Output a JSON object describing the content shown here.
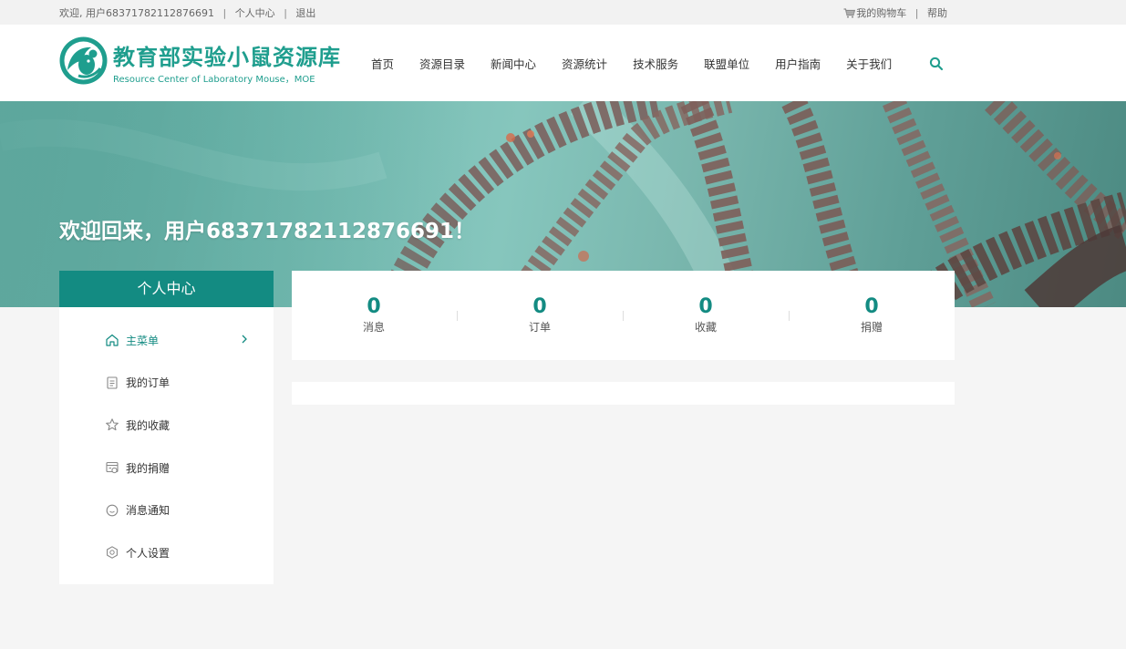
{
  "topbar": {
    "welcome": "欢迎, 用户68371782112876691",
    "sep1": "|",
    "personal_center": "个人中心",
    "sep2": "|",
    "logout": "退出",
    "cart": "我的购物车",
    "sep3": "|",
    "help": "帮助"
  },
  "logo": {
    "cn": "教育部实验小鼠资源库",
    "en": "Resource Center of Laboratory Mouse，MOE"
  },
  "nav": {
    "items": [
      "首页",
      "资源目录",
      "新闻中心",
      "资源统计",
      "技术服务",
      "联盟单位",
      "用户指南",
      "关于我们"
    ]
  },
  "banner": {
    "title": "欢迎回来，用户68371782112876691！"
  },
  "sidebar": {
    "title": "个人中心",
    "items": [
      {
        "label": "主菜单",
        "icon": "home-icon"
      },
      {
        "label": "我的订单",
        "icon": "order-icon"
      },
      {
        "label": "我的收藏",
        "icon": "star-icon"
      },
      {
        "label": "我的捐赠",
        "icon": "donation-icon"
      },
      {
        "label": "消息通知",
        "icon": "message-icon"
      },
      {
        "label": "个人设置",
        "icon": "settings-icon"
      }
    ]
  },
  "stats": [
    {
      "value": "0",
      "label": "消息"
    },
    {
      "value": "0",
      "label": "订单"
    },
    {
      "value": "0",
      "label": "收藏"
    },
    {
      "value": "0",
      "label": "捐赠"
    }
  ],
  "colors": {
    "accent": "#138b82",
    "logo": "#1f9e8e"
  }
}
